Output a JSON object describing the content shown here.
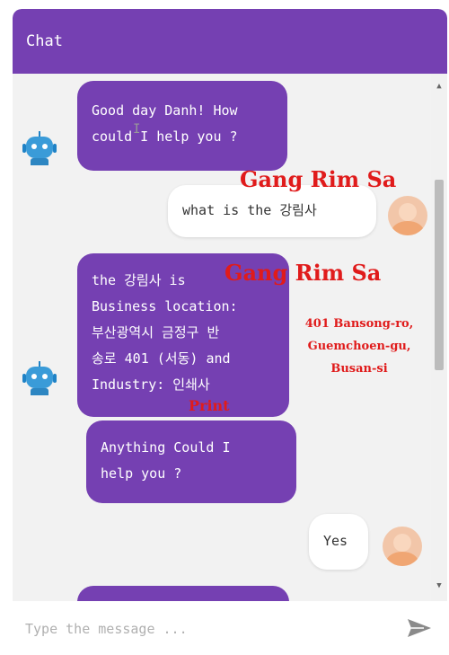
{
  "header": {
    "title": "Chat"
  },
  "messages": [
    {
      "sender": "bot",
      "lines": [
        "Good day Danh! How",
        "could I help you ?"
      ]
    },
    {
      "sender": "user",
      "text": "what is the 강림사"
    },
    {
      "sender": "bot",
      "lines": [
        "the 강림사 is",
        "Business location:",
        "부산광역시 금정구 반",
        "송로 401 (서동) and",
        "Industry: 인쇄사"
      ]
    },
    {
      "sender": "bot",
      "lines": [
        "Anything Could I",
        "help you ?"
      ]
    },
    {
      "sender": "user",
      "text": "Yes"
    }
  ],
  "annotations": {
    "name_top": "Gang Rim Sa",
    "name_mid": "Gang Rim Sa",
    "address": [
      "401 Bansong-ro,",
      "Guemchoen-gu,",
      "Busan-si"
    ],
    "industry": "Print"
  },
  "input": {
    "placeholder": "Type the message ..."
  },
  "icons": {
    "bot_avatar": "robot-icon",
    "user_avatar": "user-icon",
    "send": "send-icon",
    "scroll_up": "arrow-up-icon",
    "scroll_down": "arrow-down-icon"
  },
  "colors": {
    "accent": "#7540b2",
    "annotation": "#e01b1b",
    "background": "#f2f2f2"
  }
}
